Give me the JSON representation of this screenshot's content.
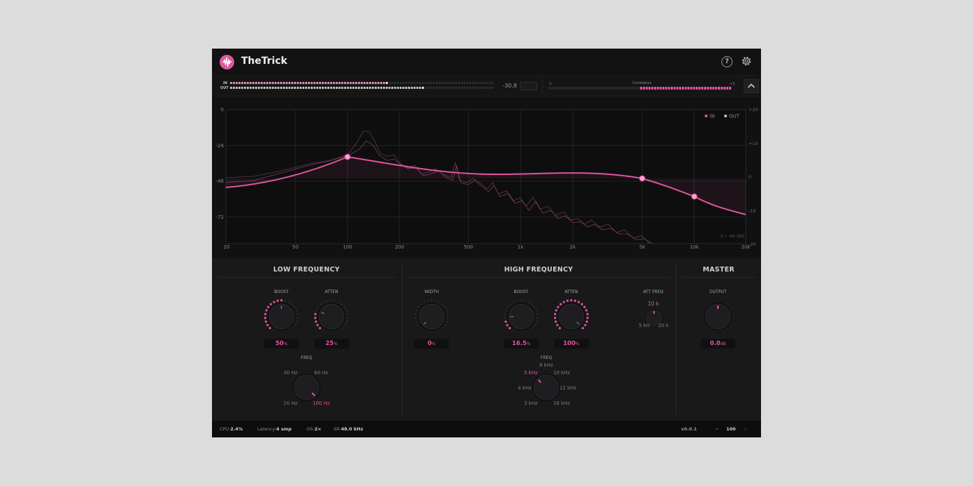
{
  "header": {
    "title": "TheTrick",
    "logo_icon": "waveform-logo-icon",
    "help_icon": "help-icon",
    "settings_icon": "gear-icon"
  },
  "meters": {
    "in_label": "IN",
    "out_label": "OUT",
    "in_level": 0.6,
    "out_level": 0.74,
    "peak_readout": "-30.8",
    "correlation_min_label": "-1",
    "correlation_label": "Correlation",
    "correlation_max_label": "+1",
    "correlation_value": 0.5
  },
  "graph": {
    "y_labels_left": [
      "0",
      "-24",
      "-48",
      "-72"
    ],
    "y_labels_right": [
      "+20",
      "+10",
      "0",
      "-10",
      "-20"
    ],
    "x_labels": [
      "20",
      "50",
      "100",
      "200",
      "500",
      "1k",
      "2k",
      "5k",
      "10k",
      "20k"
    ],
    "legend_in": "IN",
    "legend_out": "OUT",
    "range_note": "0 / -48 dBF",
    "accent": "#e0559f"
  },
  "low_frequency": {
    "title": "LOW FREQUENCY",
    "boost_label": "BOOST",
    "boost_value": "50",
    "boost_unit": "%",
    "boost_level": 0.5,
    "atten_label": "ATTEN",
    "atten_value": "25",
    "atten_unit": "%",
    "atten_level": 0.25,
    "freq_label": "FREQ",
    "freq_options": [
      "30 Hz",
      "60 Hz",
      "20 Hz",
      "100 Hz"
    ],
    "freq_selected": "100 Hz"
  },
  "high_frequency": {
    "title": "HIGH FREQUENCY",
    "width_label": "WIDTH",
    "width_value": "0",
    "width_unit": "%",
    "width_level": 0,
    "boost_label": "BOOST",
    "boost_value": "16.5",
    "boost_unit": "%",
    "boost_level": 0.165,
    "atten_label": "ATTEN",
    "atten_value": "100",
    "atten_unit": "%",
    "atten_level": 1.0,
    "att_freq_label": "ATT FREQ",
    "att_freq_value": "10 k",
    "att_freq_min": "5 kH",
    "att_freq_max": "20 k",
    "freq_label": "FREQ",
    "freq_options": [
      "8 kHz",
      "5 kHz",
      "10 kHz",
      "4 kHz",
      "12 kHz",
      "3 kHz",
      "16 kHz"
    ],
    "freq_selected": "5 kHz"
  },
  "master": {
    "title": "MASTER",
    "output_label": "OUTPUT",
    "output_value": "0.0",
    "output_unit": "dB"
  },
  "footer": {
    "cpu_label": "CPU:",
    "cpu_value": "2.4%",
    "latency_label": "Latency:",
    "latency_value": "4 smp",
    "os_label": "OS:",
    "os_value": "2×",
    "sr_label": "SR:",
    "sr_value": "48.0 kHz",
    "version": "v0.0.1",
    "zoom_minus": "−",
    "zoom_value": "100",
    "zoom_plus": "+"
  }
}
